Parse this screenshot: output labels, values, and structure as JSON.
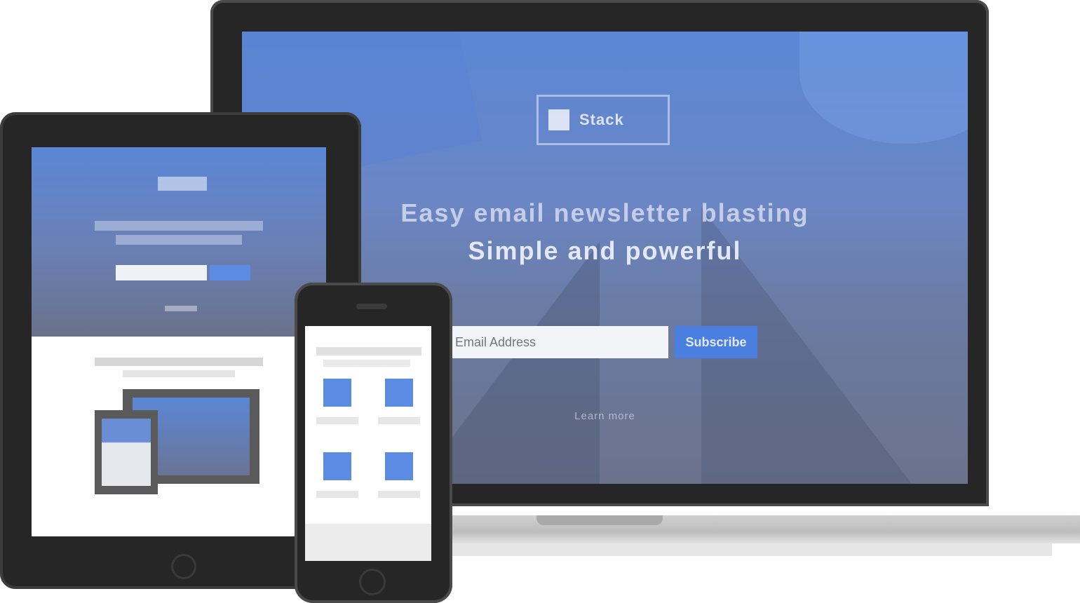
{
  "laptop": {
    "logo_text": "Stack",
    "headline": "Easy email newsletter blasting",
    "subheadline": "Simple and powerful",
    "email_placeholder": "Email Address",
    "submit_label": "Subscribe",
    "footer_link": "Learn more"
  },
  "colors": {
    "accent_blue": "#4a7fe0",
    "device_frame": "#262626",
    "hero_top": "#5b87d6",
    "hero_bottom": "#6b728c"
  }
}
